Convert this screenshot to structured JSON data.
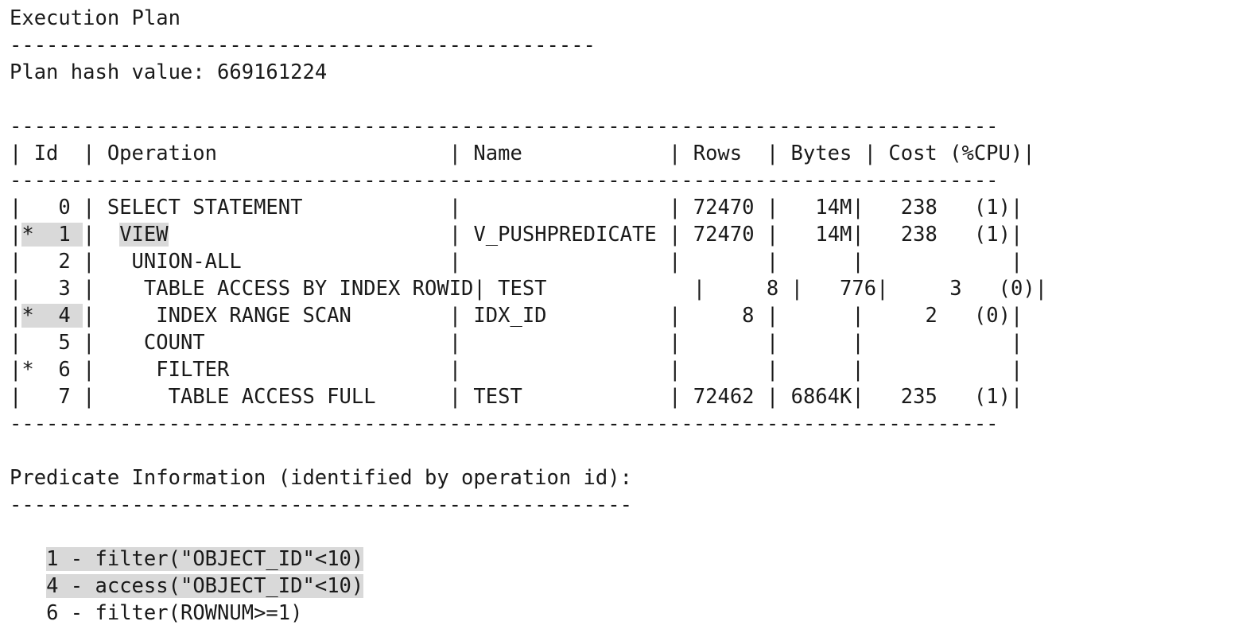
{
  "document": {
    "title": "Execution Plan",
    "rule_top": "------------------------------------------------",
    "plan_hash_label": "Plan hash value:",
    "plan_hash_value": "669161224"
  },
  "theme": {
    "background": "#ffffff",
    "text": "#1a1a1a",
    "highlight": "#d9d9d9"
  },
  "plan_table": {
    "rule": "--------------------------------------------------------------------------------",
    "columns": [
      "Id",
      "Operation",
      "Name",
      "Rows",
      "Bytes",
      "Cost (%CPU)"
    ],
    "header_line": "| Id  | Operation                     | Name            | Rows  | Bytes | Cost (%CPU)|",
    "rows": [
      {
        "id": "0",
        "starred": false,
        "id_highlighted": false,
        "operation": "SELECT STATEMENT",
        "operation_highlighted": false,
        "indent": 0,
        "name": "",
        "rows": "72470",
        "bytes": "14M",
        "cost": "238",
        "cpu": "(1)"
      },
      {
        "id": "1",
        "starred": true,
        "id_highlighted": true,
        "operation": "VIEW",
        "operation_highlighted": true,
        "indent": 1,
        "name": "V_PUSHPREDICATE",
        "rows": "72470",
        "bytes": "14M",
        "cost": "238",
        "cpu": "(1)"
      },
      {
        "id": "2",
        "starred": false,
        "id_highlighted": false,
        "operation": "UNION-ALL",
        "operation_highlighted": false,
        "indent": 2,
        "name": "",
        "rows": "",
        "bytes": "",
        "cost": "",
        "cpu": ""
      },
      {
        "id": "3",
        "starred": false,
        "id_highlighted": false,
        "operation": "TABLE ACCESS BY INDEX ROWID",
        "operation_highlighted": false,
        "indent": 3,
        "name": "TEST",
        "rows": "8",
        "bytes": "776",
        "cost": "3",
        "cpu": "(0)"
      },
      {
        "id": "4",
        "starred": true,
        "id_highlighted": true,
        "operation": "INDEX RANGE SCAN",
        "operation_highlighted": false,
        "indent": 4,
        "name": "IDX_ID",
        "rows": "8",
        "bytes": "",
        "cost": "2",
        "cpu": "(0)"
      },
      {
        "id": "5",
        "starred": false,
        "id_highlighted": false,
        "operation": "COUNT",
        "operation_highlighted": false,
        "indent": 3,
        "name": "",
        "rows": "",
        "bytes": "",
        "cost": "",
        "cpu": ""
      },
      {
        "id": "6",
        "starred": true,
        "id_highlighted": false,
        "operation": "FILTER",
        "operation_highlighted": false,
        "indent": 4,
        "name": "",
        "rows": "",
        "bytes": "",
        "cost": "",
        "cpu": ""
      },
      {
        "id": "7",
        "starred": false,
        "id_highlighted": false,
        "operation": "TABLE ACCESS FULL",
        "operation_highlighted": false,
        "indent": 5,
        "name": "TEST",
        "rows": "72462",
        "bytes": "6864K",
        "cost": "235",
        "cpu": "(1)"
      }
    ]
  },
  "predicate_section": {
    "heading": "Predicate Information (identified by operation id):",
    "rule": "---------------------------------------------------",
    "entries": [
      {
        "id": "1",
        "dash": "-",
        "text": "filter(\"OBJECT_ID\"<10)",
        "highlighted": true
      },
      {
        "id": "4",
        "dash": "-",
        "text": "access(\"OBJECT_ID\"<10)",
        "highlighted": true
      },
      {
        "id": "6",
        "dash": "-",
        "text": "filter(ROWNUM>=1)",
        "highlighted": false
      }
    ]
  },
  "rendered_lines": {
    "l01": "Execution Plan",
    "l02": "------------------------------------------------",
    "l03": "Plan hash value: 669161224",
    "l05": "---------------------------------------------------------------------------------",
    "l06": "| Id  | Operation                   | Name            | Rows  | Bytes | Cost (%CPU)|",
    "l07": "---------------------------------------------------------------------------------",
    "l16": "---------------------------------------------------------------------------------",
    "l18": "Predicate Information (identified by operation id):",
    "l19": "---------------------------------------------------"
  }
}
